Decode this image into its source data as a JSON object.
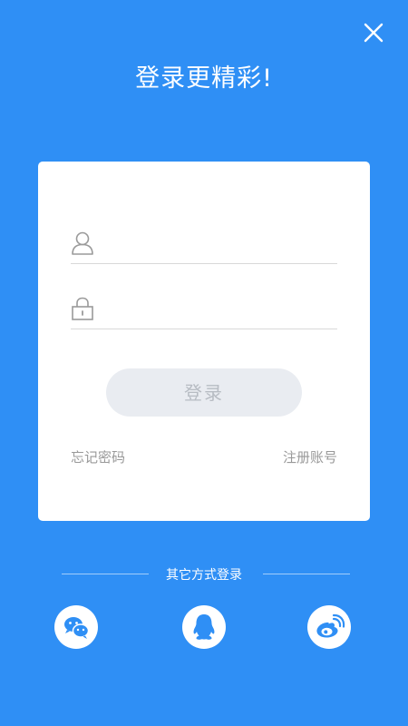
{
  "header": {
    "title": "登录更精彩!",
    "close_icon": "close-icon"
  },
  "form": {
    "username": {
      "icon": "user-icon",
      "value": "",
      "placeholder": ""
    },
    "password": {
      "icon": "lock-icon",
      "value": "",
      "placeholder": ""
    },
    "login_label": "登录",
    "forgot_label": "忘记密码",
    "register_label": "注册账号"
  },
  "other_login": {
    "label": "其它方式登录",
    "providers": [
      {
        "name": "wechat",
        "icon": "wechat-icon"
      },
      {
        "name": "qq",
        "icon": "qq-icon"
      },
      {
        "name": "weibo",
        "icon": "weibo-icon"
      }
    ]
  },
  "colors": {
    "background": "#2f8ff5",
    "card": "#ffffff",
    "button_bg": "#e9ecf1",
    "button_text": "#b7bcc3",
    "link_text": "#999999"
  }
}
